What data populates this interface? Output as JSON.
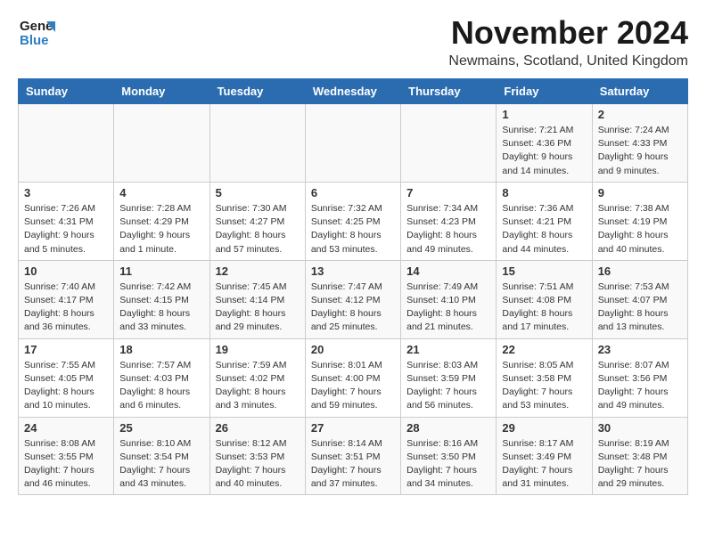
{
  "logo": {
    "line1": "General",
    "line2": "Blue"
  },
  "title": "November 2024",
  "subtitle": "Newmains, Scotland, United Kingdom",
  "weekdays": [
    "Sunday",
    "Monday",
    "Tuesday",
    "Wednesday",
    "Thursday",
    "Friday",
    "Saturday"
  ],
  "weeks": [
    [
      {
        "day": "",
        "detail": ""
      },
      {
        "day": "",
        "detail": ""
      },
      {
        "day": "",
        "detail": ""
      },
      {
        "day": "",
        "detail": ""
      },
      {
        "day": "",
        "detail": ""
      },
      {
        "day": "1",
        "detail": "Sunrise: 7:21 AM\nSunset: 4:36 PM\nDaylight: 9 hours and 14 minutes."
      },
      {
        "day": "2",
        "detail": "Sunrise: 7:24 AM\nSunset: 4:33 PM\nDaylight: 9 hours and 9 minutes."
      }
    ],
    [
      {
        "day": "3",
        "detail": "Sunrise: 7:26 AM\nSunset: 4:31 PM\nDaylight: 9 hours and 5 minutes."
      },
      {
        "day": "4",
        "detail": "Sunrise: 7:28 AM\nSunset: 4:29 PM\nDaylight: 9 hours and 1 minute."
      },
      {
        "day": "5",
        "detail": "Sunrise: 7:30 AM\nSunset: 4:27 PM\nDaylight: 8 hours and 57 minutes."
      },
      {
        "day": "6",
        "detail": "Sunrise: 7:32 AM\nSunset: 4:25 PM\nDaylight: 8 hours and 53 minutes."
      },
      {
        "day": "7",
        "detail": "Sunrise: 7:34 AM\nSunset: 4:23 PM\nDaylight: 8 hours and 49 minutes."
      },
      {
        "day": "8",
        "detail": "Sunrise: 7:36 AM\nSunset: 4:21 PM\nDaylight: 8 hours and 44 minutes."
      },
      {
        "day": "9",
        "detail": "Sunrise: 7:38 AM\nSunset: 4:19 PM\nDaylight: 8 hours and 40 minutes."
      }
    ],
    [
      {
        "day": "10",
        "detail": "Sunrise: 7:40 AM\nSunset: 4:17 PM\nDaylight: 8 hours and 36 minutes."
      },
      {
        "day": "11",
        "detail": "Sunrise: 7:42 AM\nSunset: 4:15 PM\nDaylight: 8 hours and 33 minutes."
      },
      {
        "day": "12",
        "detail": "Sunrise: 7:45 AM\nSunset: 4:14 PM\nDaylight: 8 hours and 29 minutes."
      },
      {
        "day": "13",
        "detail": "Sunrise: 7:47 AM\nSunset: 4:12 PM\nDaylight: 8 hours and 25 minutes."
      },
      {
        "day": "14",
        "detail": "Sunrise: 7:49 AM\nSunset: 4:10 PM\nDaylight: 8 hours and 21 minutes."
      },
      {
        "day": "15",
        "detail": "Sunrise: 7:51 AM\nSunset: 4:08 PM\nDaylight: 8 hours and 17 minutes."
      },
      {
        "day": "16",
        "detail": "Sunrise: 7:53 AM\nSunset: 4:07 PM\nDaylight: 8 hours and 13 minutes."
      }
    ],
    [
      {
        "day": "17",
        "detail": "Sunrise: 7:55 AM\nSunset: 4:05 PM\nDaylight: 8 hours and 10 minutes."
      },
      {
        "day": "18",
        "detail": "Sunrise: 7:57 AM\nSunset: 4:03 PM\nDaylight: 8 hours and 6 minutes."
      },
      {
        "day": "19",
        "detail": "Sunrise: 7:59 AM\nSunset: 4:02 PM\nDaylight: 8 hours and 3 minutes."
      },
      {
        "day": "20",
        "detail": "Sunrise: 8:01 AM\nSunset: 4:00 PM\nDaylight: 7 hours and 59 minutes."
      },
      {
        "day": "21",
        "detail": "Sunrise: 8:03 AM\nSunset: 3:59 PM\nDaylight: 7 hours and 56 minutes."
      },
      {
        "day": "22",
        "detail": "Sunrise: 8:05 AM\nSunset: 3:58 PM\nDaylight: 7 hours and 53 minutes."
      },
      {
        "day": "23",
        "detail": "Sunrise: 8:07 AM\nSunset: 3:56 PM\nDaylight: 7 hours and 49 minutes."
      }
    ],
    [
      {
        "day": "24",
        "detail": "Sunrise: 8:08 AM\nSunset: 3:55 PM\nDaylight: 7 hours and 46 minutes."
      },
      {
        "day": "25",
        "detail": "Sunrise: 8:10 AM\nSunset: 3:54 PM\nDaylight: 7 hours and 43 minutes."
      },
      {
        "day": "26",
        "detail": "Sunrise: 8:12 AM\nSunset: 3:53 PM\nDaylight: 7 hours and 40 minutes."
      },
      {
        "day": "27",
        "detail": "Sunrise: 8:14 AM\nSunset: 3:51 PM\nDaylight: 7 hours and 37 minutes."
      },
      {
        "day": "28",
        "detail": "Sunrise: 8:16 AM\nSunset: 3:50 PM\nDaylight: 7 hours and 34 minutes."
      },
      {
        "day": "29",
        "detail": "Sunrise: 8:17 AM\nSunset: 3:49 PM\nDaylight: 7 hours and 31 minutes."
      },
      {
        "day": "30",
        "detail": "Sunrise: 8:19 AM\nSunset: 3:48 PM\nDaylight: 7 hours and 29 minutes."
      }
    ]
  ]
}
